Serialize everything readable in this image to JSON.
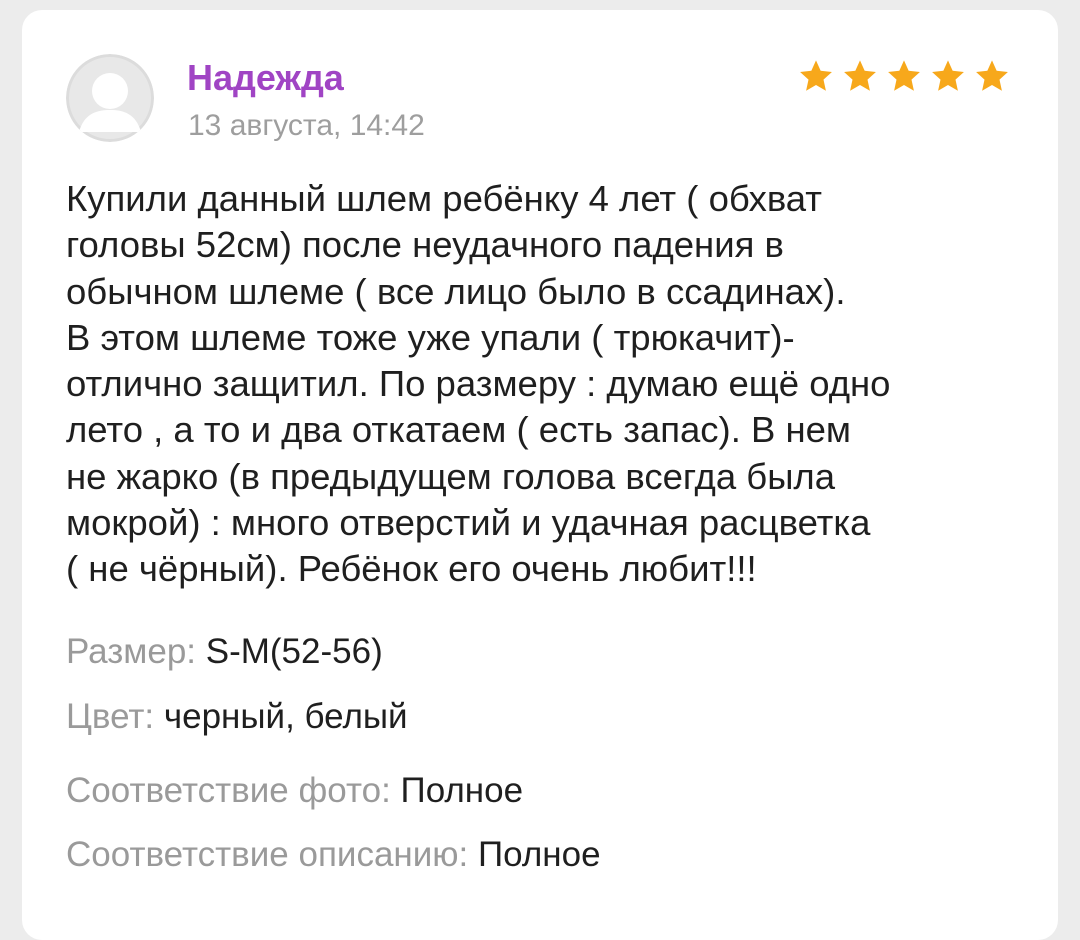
{
  "review": {
    "author": "Надежда",
    "date": "13 августа, 14:42",
    "rating": 5,
    "rating_max": 5,
    "text": "Купили данный шлем ребёнку 4 лет ( обхват\nголовы 52см) после неудачного падения в\nобычном шлеме ( все лицо было в ссадинах).\nВ этом шлеме тоже уже упали ( трюкачит)-\nотлично защитил. По размеру : думаю ещё одно\nлето , а то и два откатаем ( есть запас). В нем\nне жарко (в предыдущем голова всегда была\nмокрой) : много отверстий и удачная расцветка\n( не чёрный). Ребёнок его очень любит!!!",
    "attributes": [
      {
        "label": "Размер: ",
        "value": "S-M(52-56)"
      },
      {
        "label": "Цвет: ",
        "value": "черный, белый"
      },
      {
        "label": "Соответствие фото: ",
        "value": "Полное"
      },
      {
        "label": "Соответствие описанию: ",
        "value": "Полное"
      }
    ]
  },
  "icons": {
    "avatar": "user-placeholder-icon",
    "star": "star-icon"
  },
  "colors": {
    "author_name": "#a044c4",
    "star": "#f7a81b",
    "muted_text": "#9a9a9a",
    "body_text": "#1f1f1f",
    "avatar_bg": "#e6e6e6"
  }
}
